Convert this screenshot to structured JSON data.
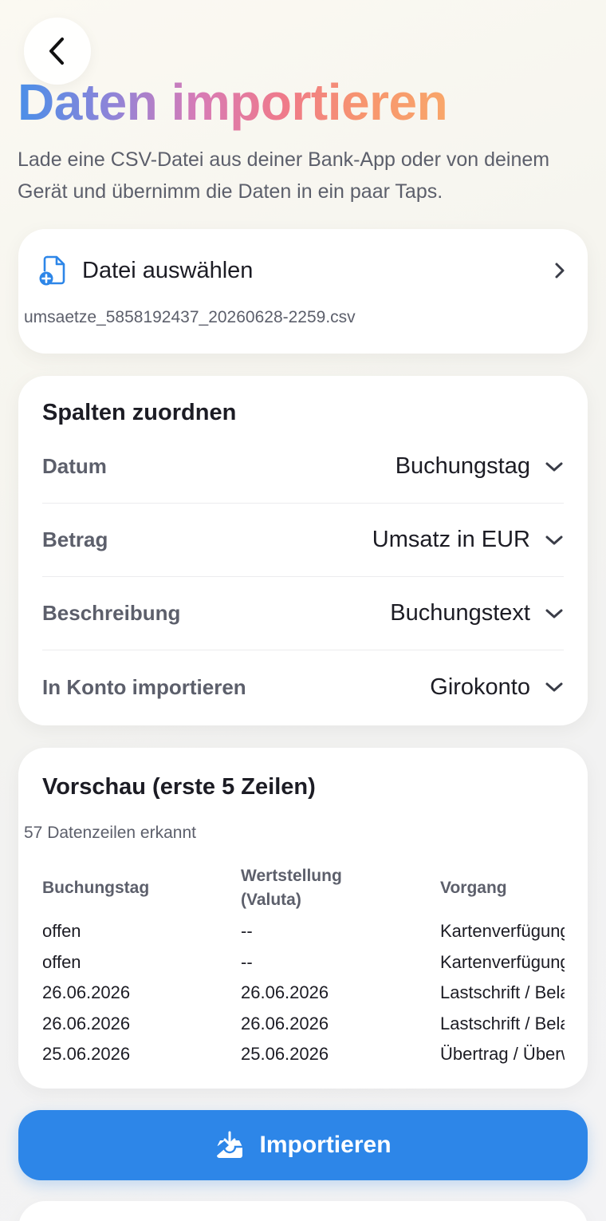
{
  "header": {
    "title": "Daten importieren",
    "subtitle": "Lade eine CSV-Datei aus deiner Bank-App oder von deinem Gerät und übernimm die Daten in ein paar Taps."
  },
  "file": {
    "label": "Datei auswählen",
    "filename": "umsaetze_5858192437_20260628-2259.csv"
  },
  "mapping": {
    "title": "Spalten zuordnen",
    "rows": [
      {
        "label": "Datum",
        "value": "Buchungstag"
      },
      {
        "label": "Betrag",
        "value": "Umsatz in EUR"
      },
      {
        "label": "Beschreibung",
        "value": "Buchungstext"
      },
      {
        "label": "In Konto importieren",
        "value": "Girokonto"
      }
    ]
  },
  "preview": {
    "title": "Vorschau (erste 5 Zeilen)",
    "count": "57 Datenzeilen erkannt",
    "columns": [
      "Buchungstag",
      "Wertstellung (Valuta)",
      "Vorgang"
    ],
    "rows": [
      [
        "offen",
        "--",
        "Kartenverfügung"
      ],
      [
        "offen",
        "--",
        "Kartenverfügung"
      ],
      [
        "26.06.2026",
        "26.06.2026",
        "Lastschrift / Belastung"
      ],
      [
        "26.06.2026",
        "26.06.2026",
        "Lastschrift / Belastung"
      ],
      [
        "25.06.2026",
        "25.06.2026",
        "Übertrag / Überweisung"
      ]
    ]
  },
  "action": {
    "import_label": "Importieren"
  },
  "colors": {
    "accent": "#2d86e8",
    "title_gradient": [
      "#4a8fe8",
      "#d77bb6",
      "#f9a66a"
    ]
  },
  "icons": {
    "back": "chevron-left-icon",
    "file": "file-add-icon",
    "file_chevron": "chevron-right-icon",
    "dropdown": "chevron-down-icon",
    "import": "tray-download-icon"
  }
}
